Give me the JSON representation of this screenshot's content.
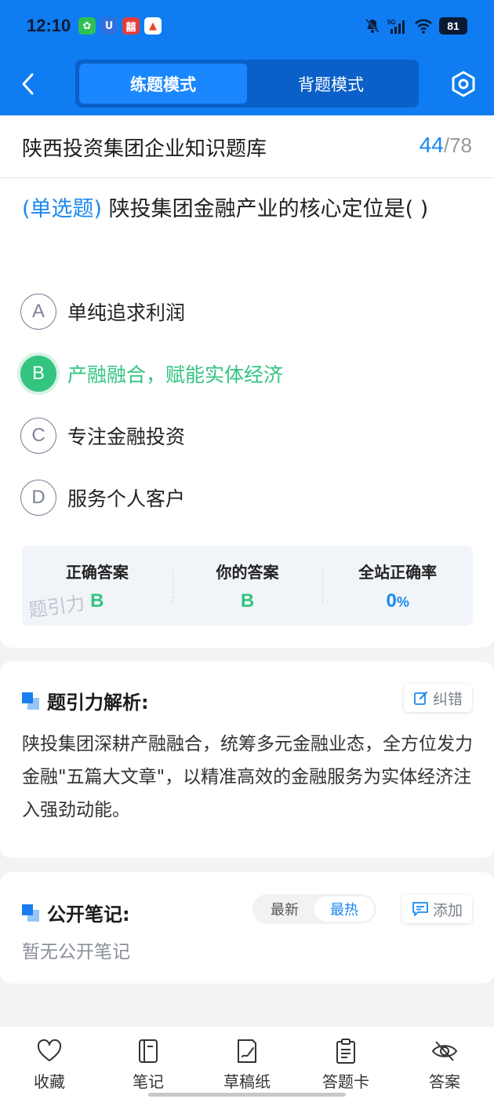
{
  "status_bar": {
    "time": "12:10",
    "battery": "81",
    "app_icons": [
      {
        "name": "wechat-icon",
        "glyph": "✿",
        "color": "#2cc152"
      },
      {
        "name": "u-app-icon",
        "glyph": "U",
        "color": "#2f6fe0"
      },
      {
        "name": "red-app-icon",
        "glyph": "囍",
        "color": "#e63c3c"
      },
      {
        "name": "triangle-app-icon",
        "glyph": "▲",
        "color": "#e8452c"
      }
    ]
  },
  "header": {
    "modes": [
      "练题模式",
      "背题模式"
    ],
    "active_mode": 0
  },
  "bank": {
    "title": "陕西投资集团企业知识题库",
    "current": "44",
    "separator": "/",
    "total": "78"
  },
  "question": {
    "type": "(单选题)",
    "text": "陕投集团金融产业的核心定位是(    )"
  },
  "options": [
    {
      "letter": "A",
      "text": "单纯追求利润"
    },
    {
      "letter": "B",
      "text": "产融融合，赋能实体经济",
      "correct": true
    },
    {
      "letter": "C",
      "text": "专注金融投资"
    },
    {
      "letter": "D",
      "text": "服务个人客户"
    }
  ],
  "answer_summary": {
    "correct_label": "正确答案",
    "correct_value": "B",
    "yours_label": "你的答案",
    "yours_value": "B",
    "rate_label": "全站正确率",
    "rate_value": "0",
    "rate_unit": "%",
    "watermark": "题引力"
  },
  "analysis": {
    "title": "题引力解析:",
    "report_label": "纠错",
    "text": "陕投集团深耕产融融合，统筹多元金融业态，全方位发力金融\"五篇大文章\"，以精准高效的金融服务为实体经济注入强劲动能。"
  },
  "notes": {
    "title": "公开笔记:",
    "sort_options": [
      "最新",
      "最热"
    ],
    "active_sort": 1,
    "add_label": "添加",
    "empty_text": "暂无公开笔记"
  },
  "bottom_nav": [
    {
      "label": "收藏",
      "icon": "heart-icon"
    },
    {
      "label": "笔记",
      "icon": "notebook-icon"
    },
    {
      "label": "草稿纸",
      "icon": "draft-paper-icon"
    },
    {
      "label": "答题卡",
      "icon": "answer-card-icon"
    },
    {
      "label": "答案",
      "icon": "eye-off-icon"
    }
  ],
  "colors": {
    "primary": "#0f7cf1",
    "accent_blue": "#1a88f0",
    "correct_green": "#33c480"
  }
}
